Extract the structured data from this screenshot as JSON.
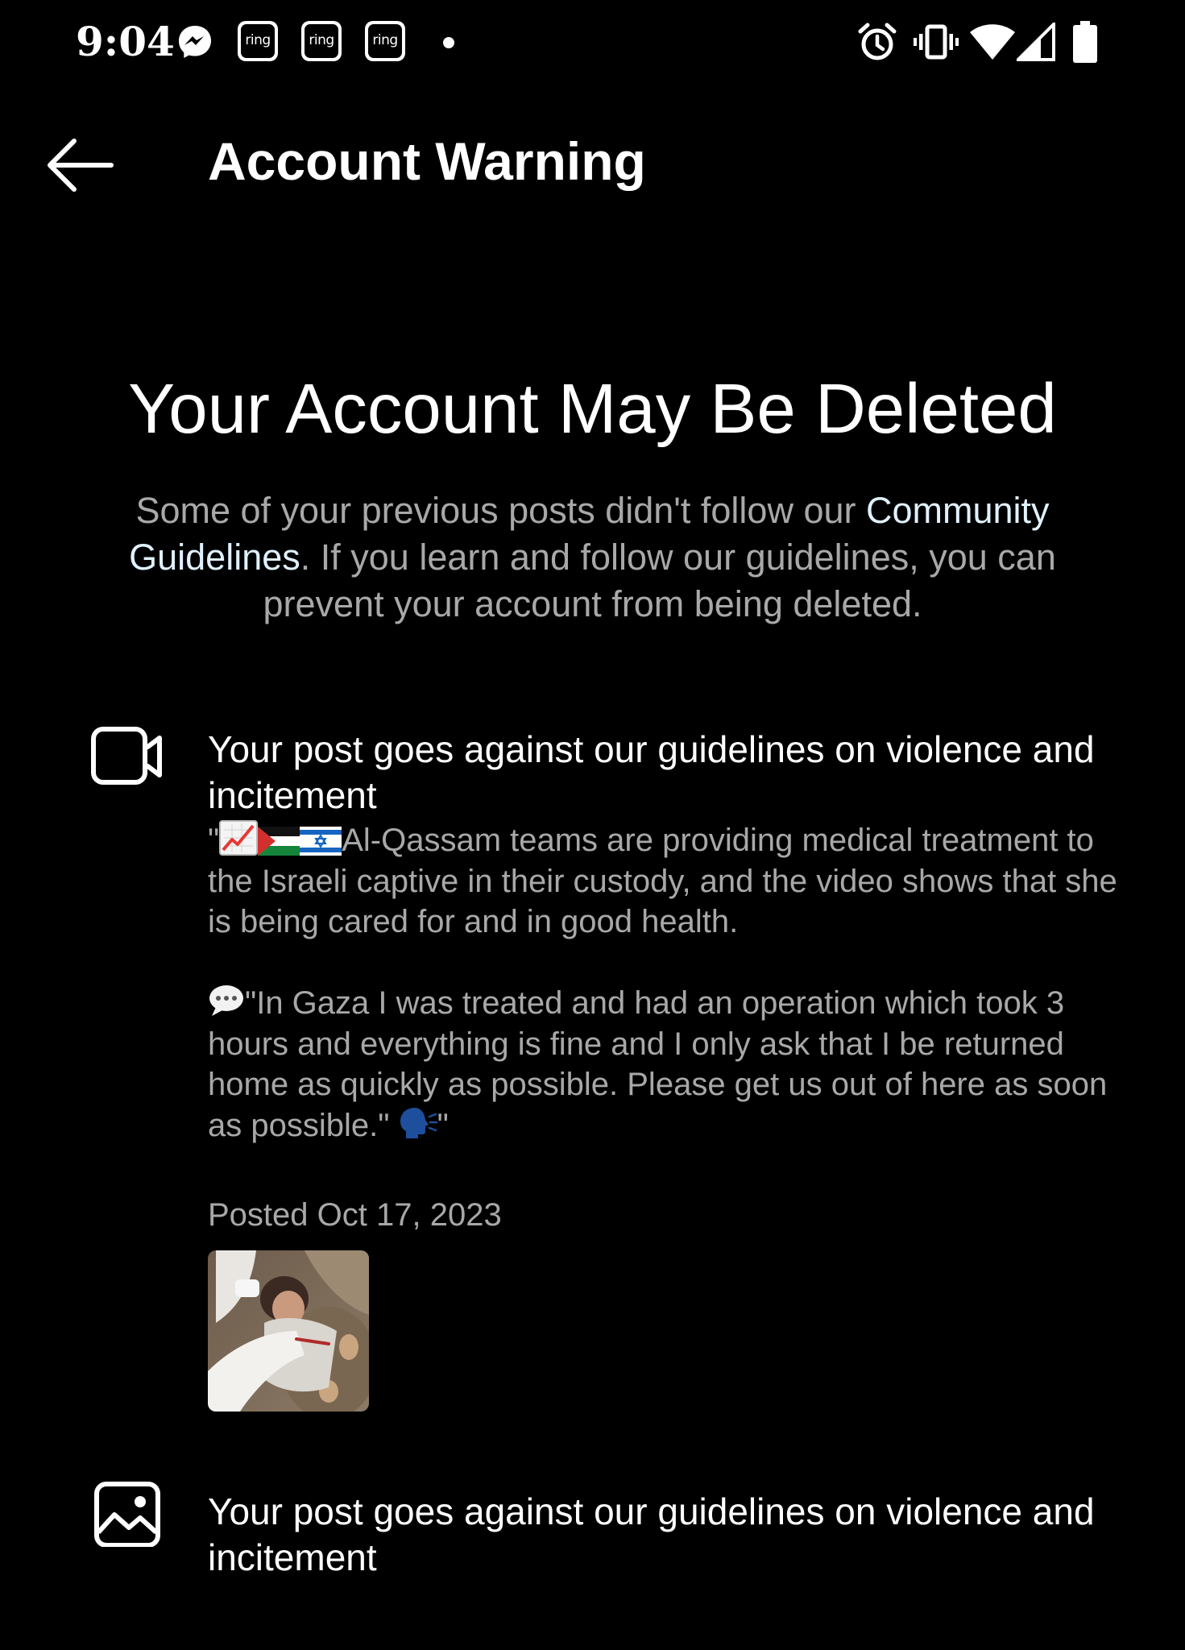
{
  "status_bar": {
    "time": "9:04",
    "notification_icons": [
      "messenger-icon",
      "ring-icon",
      "ring-icon",
      "ring-icon",
      "more-dot"
    ],
    "ring_label": "ring",
    "system_icons": [
      "alarm-icon",
      "vibrate-icon",
      "wifi-icon",
      "signal-icon",
      "battery-icon"
    ]
  },
  "header": {
    "back_icon": "arrow-left-icon",
    "title": "Account Warning"
  },
  "main": {
    "headline": "Your Account May Be Deleted",
    "intro_before": "Some of your previous posts didn't follow our ",
    "intro_link": "Community Guidelines",
    "intro_after": ". If you learn and follow our guidelines, you can prevent your account from being deleted."
  },
  "violations": [
    {
      "icon": "video-icon",
      "title": "Your post goes against our guidelines on violence and incitement",
      "post_text_1": "Al-Qassam teams are providing medical treatment to the Israeli captive in their custody, and the video shows that she is being cared for and in good health.",
      "post_text_2": "\"In Gaza I was treated and had an operation which took 3 hours and everything is fine and I only ask that I be returned home as quickly as possible. Please get us out of here as soon as possible.\"",
      "quote_open": "\"",
      "quote_close": "\"",
      "emojis": [
        "chart-increasing-emoji",
        "palestine-flag-emoji",
        "israel-flag-emoji",
        "speech-balloon-emoji",
        "speaking-head-emoji"
      ],
      "posted": "Posted Oct 17, 2023"
    },
    {
      "icon": "image-icon",
      "title": "Your post goes against our guidelines on violence and incitement"
    }
  ],
  "colors": {
    "background": "#000000",
    "primary_text": "#ffffff",
    "secondary_text": "#a8a8a8",
    "link": "#e0f1ff"
  }
}
